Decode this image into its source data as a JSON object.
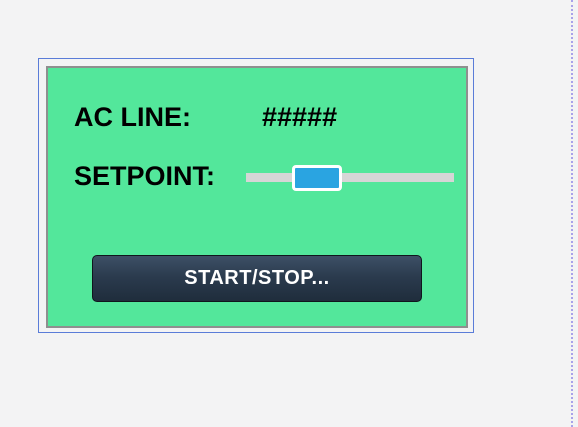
{
  "panel": {
    "background_color": "#53e79b",
    "ac_line_label": "AC LINE:",
    "ac_line_value": "#####",
    "setpoint_label": "SETPOINT:",
    "setpoint_slider": {
      "value_fraction": 0.34,
      "thumb_color": "#2aa4e1",
      "track_color": "#d6d6d6"
    },
    "start_stop_label": "START/STOP..."
  }
}
